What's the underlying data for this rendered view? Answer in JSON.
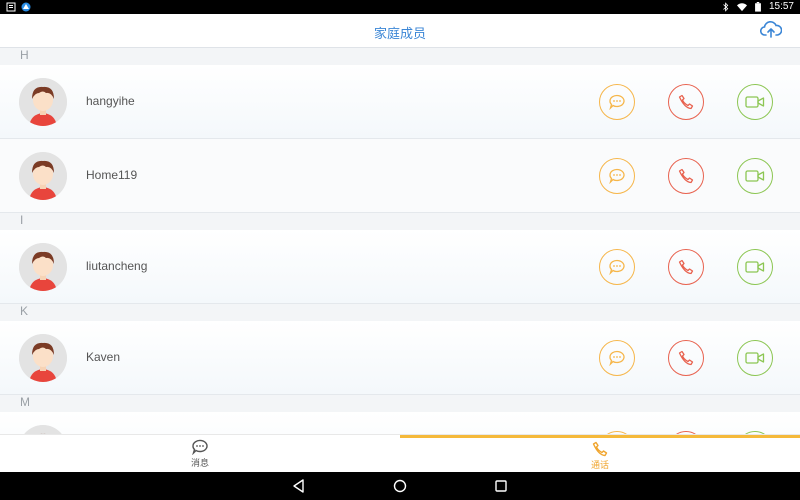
{
  "status_bar": {
    "time": "15:57"
  },
  "header": {
    "title": "家庭成员",
    "upload_icon": "cloud-upload-icon"
  },
  "sections": [
    {
      "letter": "H",
      "contacts": [
        {
          "name": "hangyihe"
        },
        {
          "name": "Home119"
        }
      ]
    },
    {
      "letter": "I",
      "contacts": [
        {
          "name": "liutancheng"
        }
      ]
    },
    {
      "letter": "K",
      "contacts": [
        {
          "name": "Kaven"
        }
      ]
    },
    {
      "letter": "M",
      "contacts": [
        {
          "name": ""
        }
      ]
    }
  ],
  "bottom_nav": {
    "messages_label": "消息",
    "calls_label": "通话"
  },
  "colors": {
    "accent_blue": "#3b86d6",
    "message": "#f6b64a",
    "call": "#e8624f",
    "video": "#8cc653",
    "active_tab": "#f5b93a"
  }
}
